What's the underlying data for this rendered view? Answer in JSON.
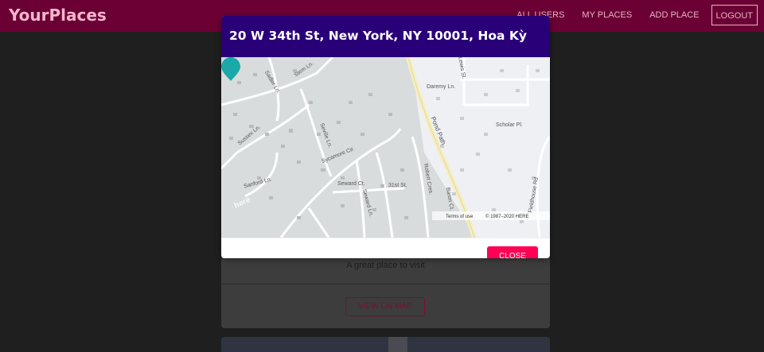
{
  "header": {
    "logo": "YourPlaces",
    "nav": {
      "all_users": "ALL USERS",
      "my_places": "MY PLACES",
      "add_place": "ADD PLACE",
      "logout": "LOGOUT"
    }
  },
  "modal": {
    "title": "20 W 34th St, New York, NY 10001, Hoa Kỳ",
    "close_label": "CLOSE",
    "map": {
      "street_labels": {
        "sadler": "Sadler Ln.",
        "stem": "Stem Ln.",
        "sussex": "Sussex Ln.",
        "seville": "Seville Ln.",
        "sycamore": "Sycamore Cir.",
        "sanford": "Sanford Ln.",
        "seward_ct": "Seward Ct.",
        "seward_ln": "Seward Ln.",
        "st31": "31st St.",
        "robert": "Robert Cres.",
        "baron": "Baron Ct.",
        "pond": "Pond Path",
        "daremy": "Daremy Ln.",
        "lewis": "Lewis St.",
        "scholar": "Scholar Pl.",
        "fieldhouse": "Fieldhouse Rd"
      },
      "brand": "here",
      "terms": "Terms of use",
      "copyright": "© 1987–2020 HERE"
    }
  },
  "card": {
    "description": "A great place to visit",
    "view_on_map": "VIEW ON MAP"
  },
  "colors": {
    "header_bg": "#6b0034",
    "modal_header_bg": "#2a0078",
    "close_button": "#ff0055",
    "pin": "#1aa8a8"
  }
}
